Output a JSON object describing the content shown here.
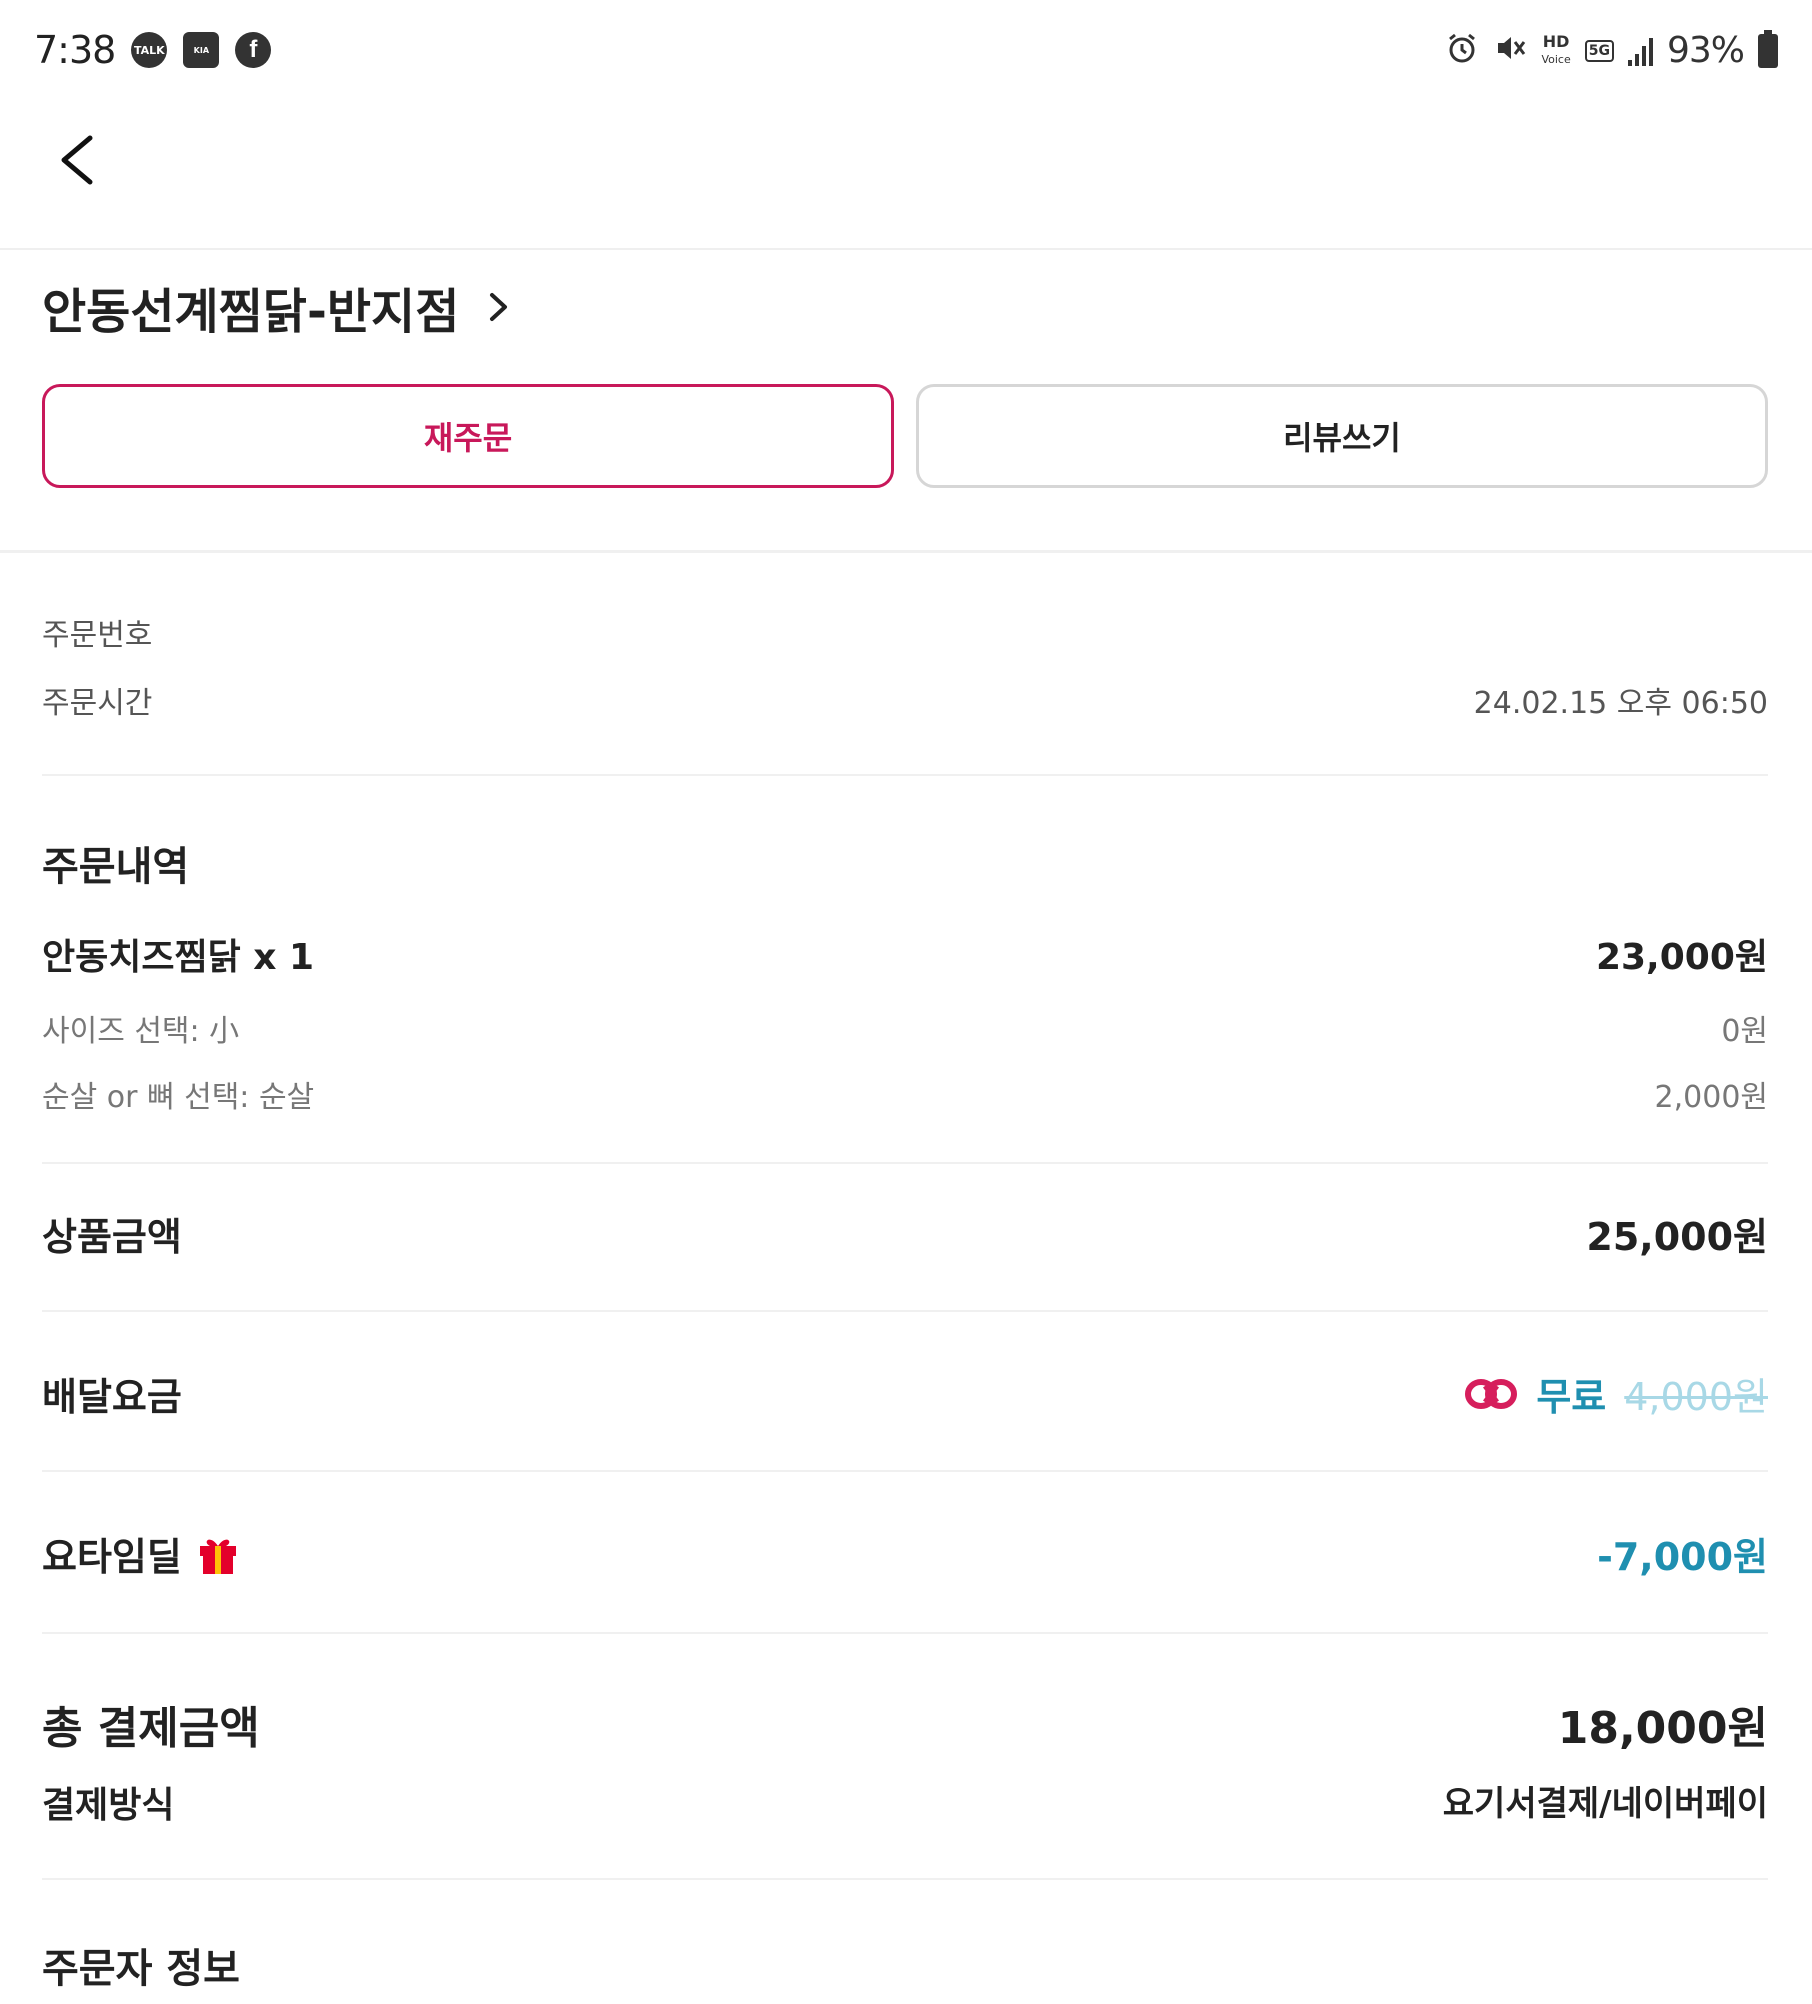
{
  "status_bar": {
    "time": "7:38",
    "apps": [
      "TALK",
      "Kia Connect",
      "f"
    ],
    "battery": "93%",
    "hd_voice": "HD",
    "network": "5G",
    "icons": [
      "alarm-icon",
      "mute-icon",
      "hd-voice-icon",
      "5g-icon",
      "signal-icon",
      "battery-icon"
    ]
  },
  "header": {
    "back_icon": "chevron-left-icon"
  },
  "store": {
    "name": "안동선계찜닭-반지점",
    "chevron": "chevron-right-icon"
  },
  "actions": {
    "reorder_label": "재주문",
    "review_label": "리뷰쓰기"
  },
  "order_info": {
    "order_number_label": "주문번호",
    "order_number_value": "",
    "order_time_label": "주문시간",
    "order_time_value": "24.02.15 오후 06:50"
  },
  "order_details": {
    "title": "주문내역",
    "items": [
      {
        "name": "안동치즈찜닭 x 1",
        "price": "23,000원",
        "options": [
          {
            "label": "사이즈 선택: 小",
            "price": "0원"
          },
          {
            "label": "순살 or 뼈 선택: 순살",
            "price": "2,000원"
          }
        ]
      }
    ]
  },
  "summary": {
    "product_amount_label": "상품금액",
    "product_amount_value": "25,000원",
    "delivery_fee_label": "배달요금",
    "delivery_fee_free": "무료",
    "delivery_fee_original": "4,000원",
    "deal_label": "요타임딜",
    "deal_value": "-7,000원",
    "total_label": "총 결제금액",
    "total_value": "18,000원",
    "payment_method_label": "결제방식",
    "payment_method_value": "요기서결제/네이버페이"
  },
  "orderer": {
    "title": "주문자 정보"
  },
  "colors": {
    "accent": "#c8185a",
    "discount": "#1f8fb0",
    "strike": "#a8d8e6",
    "divider": "#f0f0f0"
  }
}
